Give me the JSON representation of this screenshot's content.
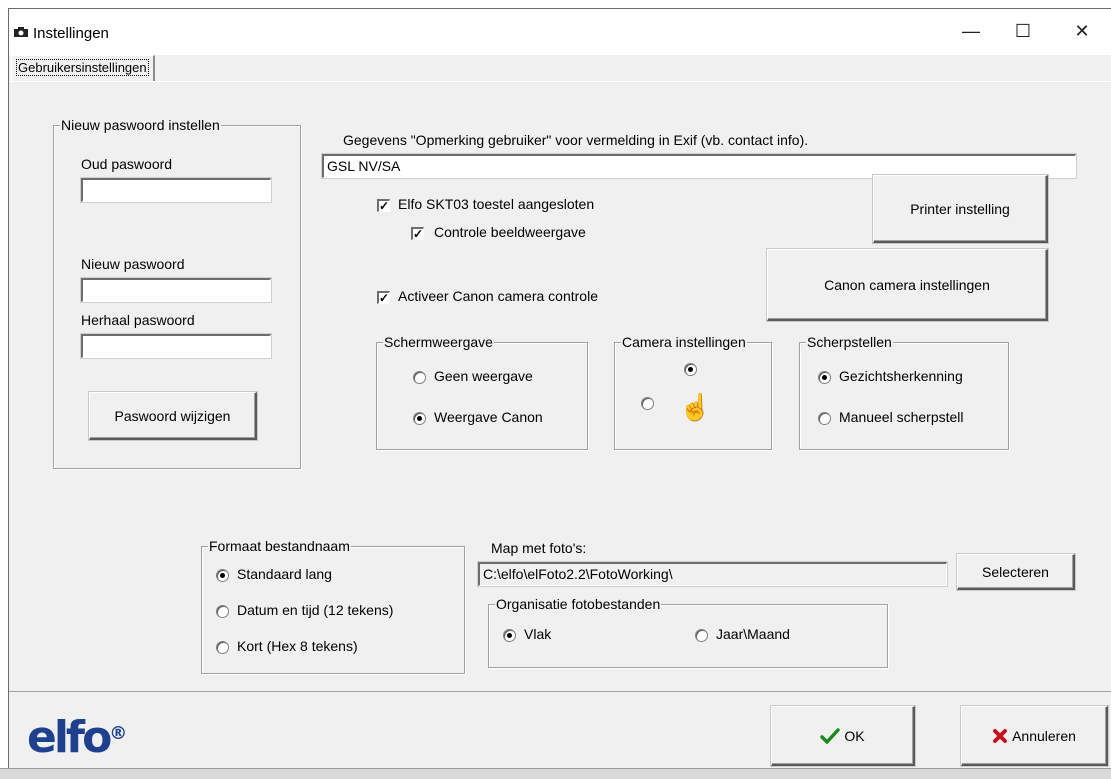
{
  "window": {
    "title": "Instellingen",
    "minimize": "—",
    "maximize": "☐",
    "close": "✕"
  },
  "tabs": [
    {
      "label": "Gebruikersinstellingen"
    }
  ],
  "password": {
    "group_title": "Nieuw paswoord instellen",
    "old_label": "Oud paswoord",
    "old_value": "",
    "new_label": "Nieuw paswoord",
    "new_value": "",
    "repeat_label": "Herhaal paswoord",
    "repeat_value": "",
    "change_button": "Paswoord wijzigen"
  },
  "exif": {
    "label": "Gegevens \"Opmerking gebruiker\" voor vermelding in Exif (vb. contact info).",
    "value": "GSL NV/SA"
  },
  "elfo": {
    "label": "Elfo SKT03 toestel aangesloten",
    "checked": true,
    "display_control_label": "Controle beeldweergave",
    "display_control_checked": true
  },
  "canon": {
    "label": "Activeer Canon camera controle",
    "checked": true
  },
  "buttons": {
    "printer": "Printer instelling",
    "canon_settings": "Canon camera instellingen",
    "select": "Selecteren",
    "ok": "OK",
    "cancel": "Annuleren"
  },
  "screen_display": {
    "title": "Schermweergave",
    "options": [
      {
        "label": "Geen weergave",
        "selected": false
      },
      {
        "label": "Weergave Canon",
        "selected": true
      }
    ]
  },
  "camera_settings": {
    "title": "Camera instellingen",
    "top_selected": true,
    "left_selected": false,
    "icon": "pointing-hand-icon",
    "icon_glyph": "☝"
  },
  "focus": {
    "title": "Scherpstellen",
    "options": [
      {
        "label": "Gezichtsherkenning",
        "selected": true
      },
      {
        "label": "Manueel scherpstell",
        "selected": false
      }
    ]
  },
  "filename_format": {
    "title": "Formaat bestandnaam",
    "options": [
      {
        "label": "Standaard lang",
        "selected": true
      },
      {
        "label": "Datum en tijd (12 tekens)",
        "selected": false
      },
      {
        "label": "Kort (Hex 8 tekens)",
        "selected": false
      }
    ]
  },
  "photo_folder": {
    "label": "Map met foto's:",
    "value": "C:\\elfo\\elFoto2.2\\FotoWorking\\"
  },
  "organisation": {
    "title": "Organisatie fotobestanden",
    "options": [
      {
        "label": "Vlak",
        "selected": true
      },
      {
        "label": "Jaar\\Maand",
        "selected": false
      }
    ]
  },
  "logo": {
    "text": "elfo",
    "mark": "®"
  },
  "colors": {
    "ok_check": "#1a8a1a",
    "cancel_x": "#c0141e",
    "logo": "#1f3f8f"
  }
}
